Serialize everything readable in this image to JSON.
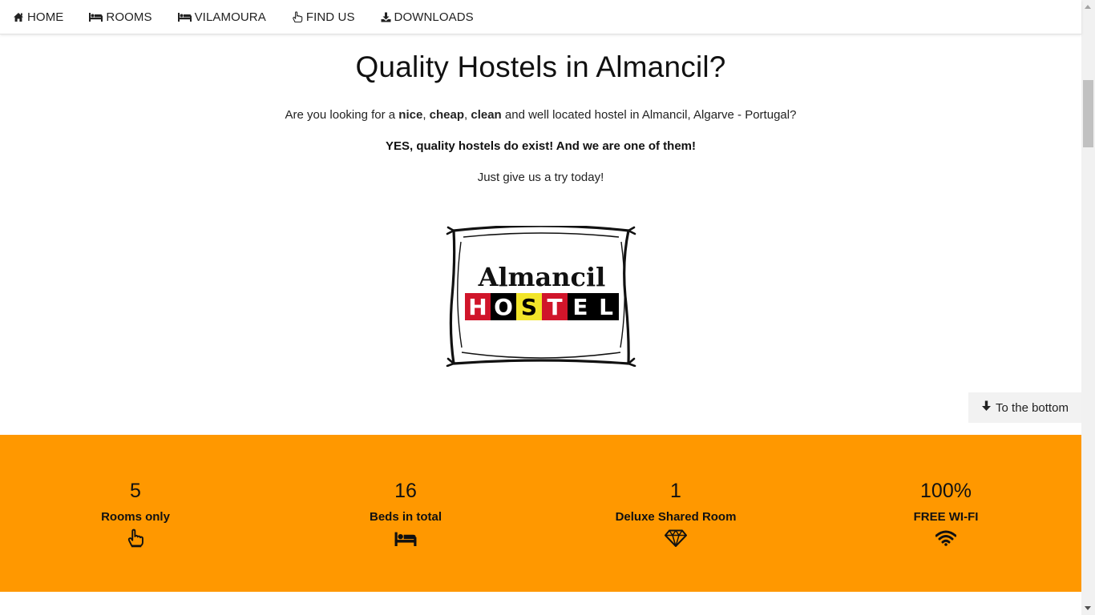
{
  "nav": {
    "items": [
      {
        "label": "HOME",
        "icon": "home-icon"
      },
      {
        "label": "ROOMS",
        "icon": "bed-icon"
      },
      {
        "label": "VILAMOURA",
        "icon": "bed-icon"
      },
      {
        "label": "FIND US",
        "icon": "hand-pointer-icon"
      },
      {
        "label": "DOWNLOADS",
        "icon": "download-icon"
      }
    ]
  },
  "main": {
    "title": "Quality Hostels in Almancil?",
    "intro": {
      "part1": "Are you looking for a ",
      "bold1": "nice",
      "sep1": ", ",
      "bold2": "cheap",
      "sep2": ", ",
      "bold3": "clean",
      "part2": " and well located hostel in Almancil, Algarve - Portugal?"
    },
    "tagline": "YES, quality hostels do exist! And we are one of them!",
    "cta": "Just give us a try today!"
  },
  "logo": {
    "line1": "Almancil",
    "letters": [
      "H",
      "O",
      "S",
      "T",
      "E",
      "L"
    ],
    "letter_bg_colors": [
      "#d0152a",
      "#000000",
      "#f2e52a",
      "#d0152a",
      "#000000",
      "#000000"
    ],
    "letter_fg_colors": [
      "#ffffff",
      "#ffffff",
      "#000000",
      "#ffffff",
      "#ffffff",
      "#ffffff"
    ]
  },
  "to_bottom": {
    "label": "To the bottom",
    "icon": "arrow-down-icon"
  },
  "stats": [
    {
      "value": "5",
      "label": "Rooms only",
      "icon": "hand-pointer-icon"
    },
    {
      "value": "16",
      "label": "Beds in total",
      "icon": "bed-icon"
    },
    {
      "value": "1",
      "label": "Deluxe Shared Room",
      "icon": "diamond-icon"
    },
    {
      "value": "100%",
      "label": "FREE WI-FI",
      "icon": "wifi-icon"
    }
  ],
  "colors": {
    "stats_band": "#ff9800",
    "text": "#111111"
  }
}
